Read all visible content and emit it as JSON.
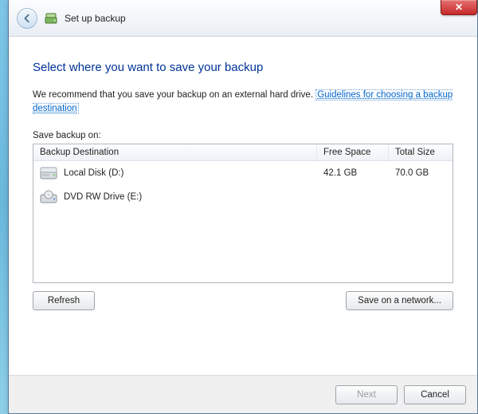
{
  "titlebar": {
    "close_glyph": "✕"
  },
  "header": {
    "title": "Set up backup"
  },
  "main": {
    "heading": "Select where you want to save your backup",
    "recommend_prefix": "We recommend that you save your backup on an external hard drive. ",
    "guidelines_link": "Guidelines for choosing a backup destination"
  },
  "list": {
    "label": "Save backup on:",
    "headers": {
      "dest": "Backup Destination",
      "free": "Free Space",
      "total": "Total Size"
    },
    "rows": [
      {
        "name": "Local Disk (D:)",
        "free": "42.1 GB",
        "total": "70.0 GB",
        "icon": "hdd"
      },
      {
        "name": "DVD RW Drive (E:)",
        "free": "",
        "total": "",
        "icon": "dvd"
      }
    ]
  },
  "buttons": {
    "refresh": "Refresh",
    "network": "Save on a network...",
    "next": "Next",
    "cancel": "Cancel"
  }
}
